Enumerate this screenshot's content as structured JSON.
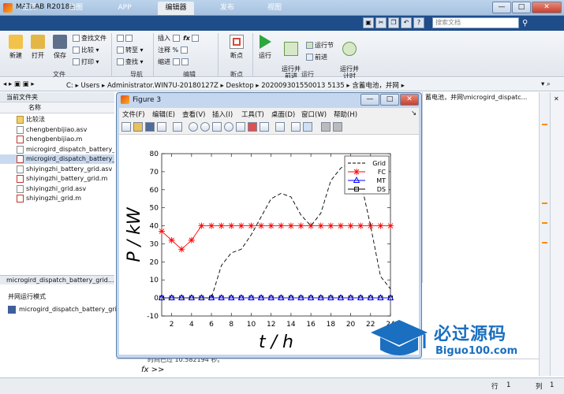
{
  "window": {
    "title": "MATLAB R2018a",
    "min": "—",
    "max": "□",
    "close": "✕"
  },
  "tabs": [
    "主页",
    "绘图",
    "APP",
    "编辑器",
    "发布",
    "视图"
  ],
  "active_tab": "编辑器",
  "search": {
    "placeholder": "搜索文档"
  },
  "ribbon": {
    "new": "新建",
    "open": "打开",
    "save": "保存",
    "find_files": "查找文件",
    "compare": "比较",
    "print": "打印",
    "goto": "转至",
    "find": "查找",
    "insert": "插入",
    "fx": "fx",
    "comment": "注释",
    "indent": "缩进",
    "breakpoints": "断点",
    "run": "运行",
    "run_advance": "运行并\n前进",
    "run_section": "运行节",
    "advance": "前进",
    "run_time": "运行并\n计时",
    "groups": {
      "file": "文件",
      "nav": "导航",
      "edit": "编辑",
      "bp": "断点",
      "run": "运行"
    }
  },
  "address": {
    "path": [
      "C:",
      "Users",
      "Administrator.WIN7U-20180127Z",
      "Desktop",
      "20200930155001351 35",
      "含蓄电池，并网"
    ],
    "path_raw": "C: ▸ Users ▸ Administrator.WIN7U-20180127Z ▸ Desktop ▸ 202009301550013 5135 ▸ 含蓄电池，并网 ▸"
  },
  "current_folder": {
    "title": "当前文件夹",
    "column": "名称",
    "items": [
      {
        "name": "比较法",
        "type": "folder"
      },
      {
        "name": "chengbenbijiao.asv",
        "type": "asv"
      },
      {
        "name": "chengbenbijiao.m",
        "type": "m"
      },
      {
        "name": "microgird_dispatch_battery_gri...",
        "type": "asv"
      },
      {
        "name": "microgird_dispatch_battery_gri...",
        "type": "m",
        "selected": true
      },
      {
        "name": "shiyingzhi_battery_grid.asv",
        "type": "asv"
      },
      {
        "name": "shiyingzhi_battery_grid.m",
        "type": "m"
      },
      {
        "name": "shiyingzhi_grid.asv",
        "type": "asv"
      },
      {
        "name": "shiyingzhi_grid.m",
        "type": "m"
      }
    ]
  },
  "details": {
    "title": "microgird_dispatch_battery_grid...",
    "section": "并网运行模式",
    "item": "microgird_dispatch_battery_grid"
  },
  "right_path": "蓄电池，并网\\microgird_dispatc...",
  "figure": {
    "title": "Figure 3",
    "menu": [
      "文件(F)",
      "编辑(E)",
      "查看(V)",
      "插入(I)",
      "工具(T)",
      "桌面(D)",
      "窗口(W)",
      "帮助(H)"
    ]
  },
  "chart_data": {
    "type": "line",
    "xlabel": "t / h",
    "ylabel": "P / kW",
    "xlim": [
      1,
      24
    ],
    "ylim": [
      -10,
      80
    ],
    "xticks": [
      2,
      4,
      6,
      8,
      10,
      12,
      14,
      16,
      18,
      20,
      22,
      24
    ],
    "yticks": [
      -10,
      0,
      10,
      20,
      30,
      40,
      50,
      60,
      70,
      80
    ],
    "legend_position": "top-right",
    "x": [
      1,
      2,
      3,
      4,
      5,
      6,
      7,
      8,
      9,
      10,
      11,
      12,
      13,
      14,
      15,
      16,
      17,
      18,
      19,
      20,
      21,
      22,
      23,
      24
    ],
    "series": [
      {
        "name": "Grid",
        "color": "#000000",
        "style": "dashed",
        "marker": "none",
        "values": [
          0,
          0,
          0,
          0,
          0,
          0,
          18,
          25,
          27,
          35,
          45,
          55,
          58,
          56,
          46,
          40,
          47,
          65,
          72,
          75,
          65,
          40,
          12,
          5
        ]
      },
      {
        "name": "FC",
        "color": "#ff0000",
        "style": "solid",
        "marker": "star",
        "values": [
          37,
          32,
          27,
          32,
          40,
          40,
          40,
          40,
          40,
          40,
          40,
          40,
          40,
          40,
          40,
          40,
          40,
          40,
          40,
          40,
          40,
          40,
          40,
          40
        ]
      },
      {
        "name": "MT",
        "color": "#0000ff",
        "style": "solid",
        "marker": "triangle",
        "values": [
          0,
          0,
          0,
          0,
          0,
          0,
          0,
          0,
          0,
          0,
          0,
          0,
          0,
          0,
          0,
          0,
          0,
          0,
          0,
          0,
          0,
          0,
          0,
          0
        ]
      },
      {
        "name": "DS",
        "color": "#000000",
        "style": "solid",
        "marker": "square",
        "values": [
          0,
          0,
          0,
          0,
          0,
          0,
          0,
          0,
          0,
          0,
          0,
          0,
          0,
          0,
          0,
          0,
          0,
          0,
          0,
          0,
          0,
          0,
          0,
          0
        ]
      }
    ]
  },
  "command": {
    "prompt": "fx >>",
    "history": "时间已过 10.582194 秒。"
  },
  "status": {
    "row_label": "行",
    "row": "1",
    "col_label": "列",
    "col": "1"
  },
  "watermark": {
    "title": "必过源码",
    "url": "Biguo100.com"
  },
  "colors": {
    "tab_bar": "#1e4d8a",
    "accent": "#ff8c00"
  }
}
